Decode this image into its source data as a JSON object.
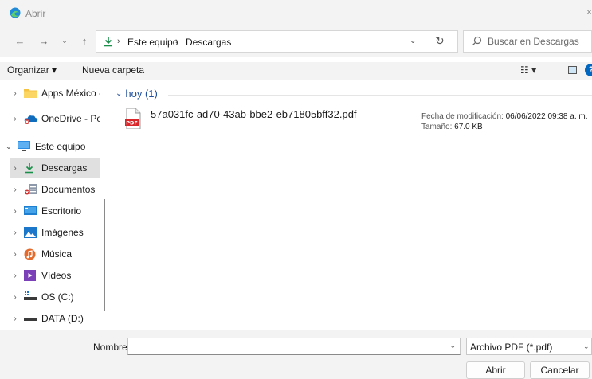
{
  "window": {
    "title": "Abrir"
  },
  "nav": {
    "back_icon": "back-arrow-icon",
    "forward_icon": "forward-arrow-icon",
    "recent_icon": "chevron-down-icon",
    "up_icon": "up-arrow-icon"
  },
  "address": {
    "crumbs": [
      "Este equipo",
      "Descargas"
    ],
    "separator": "›"
  },
  "search": {
    "placeholder": "Buscar en Descargas"
  },
  "toolbar": {
    "organize_label": "Organizar ▾",
    "new_folder_label": "Nueva carpeta",
    "view_label": "☷ ▾",
    "help_label": "?"
  },
  "sidebar": {
    "items": [
      {
        "label": "Apps México -",
        "icon": "folder-icon",
        "color": "#f6c243"
      },
      {
        "label": "OneDrive - Perso",
        "icon": "onedrive-icon",
        "color": "#0f6cbd"
      },
      {
        "label": "Este equipo",
        "icon": "computer-icon",
        "color": "#2a8be0"
      },
      {
        "label": "Descargas",
        "icon": "download-icon",
        "color": "#1a8f4a"
      },
      {
        "label": "Documentos",
        "icon": "documents-icon",
        "color": "#7a8899"
      },
      {
        "label": "Escritorio",
        "icon": "desktop-icon",
        "color": "#1e7fd0"
      },
      {
        "label": "Imágenes",
        "icon": "pictures-icon",
        "color": "#1c76c9"
      },
      {
        "label": "Música",
        "icon": "music-icon",
        "color": "#e46b2c"
      },
      {
        "label": "Vídeos",
        "icon": "videos-icon",
        "color": "#7b3fb8"
      },
      {
        "label": "OS (C:)",
        "icon": "drive-icon",
        "color": "#3a3a3a"
      },
      {
        "label": "DATA (D:)",
        "icon": "drive-icon",
        "color": "#3a3a3a"
      }
    ]
  },
  "content": {
    "group_label": "hoy (1)",
    "file": {
      "name": "57a031fc-ad70-43ab-bbe2-eb71805bff32.pdf",
      "icon_text": "PDF",
      "modified_label": "Fecha de modificación:",
      "modified_value": "06/06/2022 09:38 a. m.",
      "size_label": "Tamaño:",
      "size_value": "67.0 KB"
    }
  },
  "footer": {
    "filename_label": "Nombre:",
    "filename_value": "",
    "filetype": "Archivo PDF (*.pdf)",
    "open_label": "Abrir",
    "cancel_label": "Cancelar"
  },
  "colors": {
    "accent": "#0067c0",
    "selection": "#e0e0e0",
    "chrome": "#f3f3f3",
    "group": "#1f4e9a",
    "pdf": "#d9262a"
  }
}
